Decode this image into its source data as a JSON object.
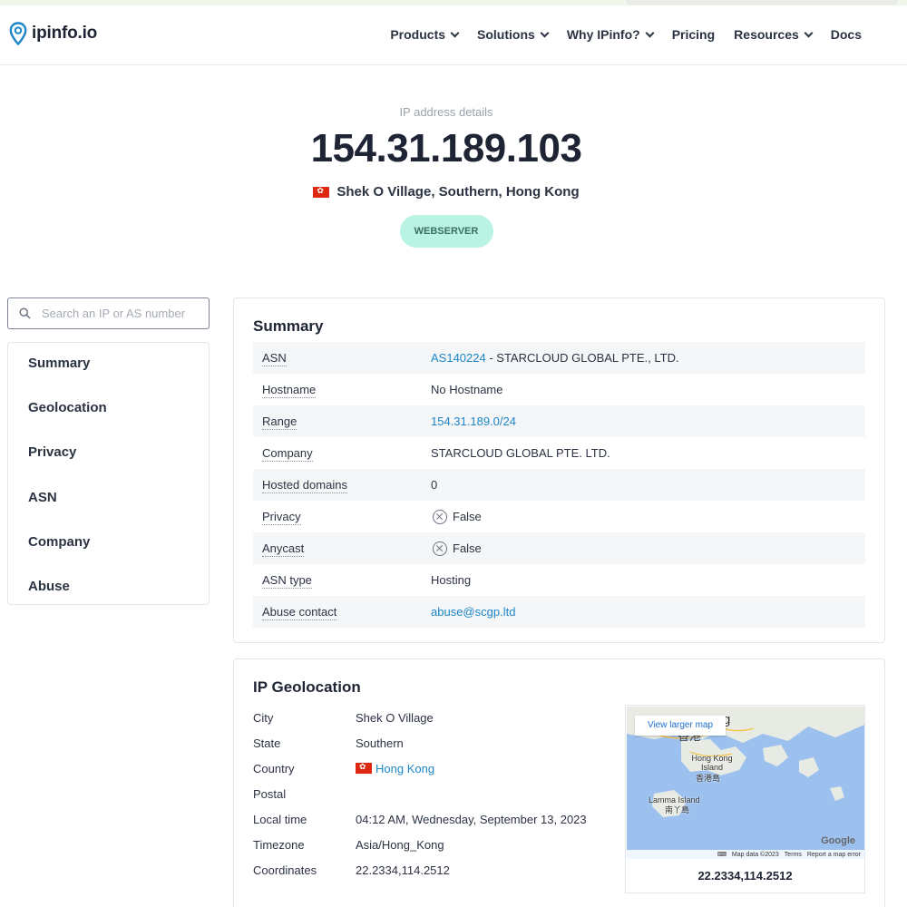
{
  "brand": {
    "name": "ipinfo.io",
    "accent": "#1c86c9"
  },
  "nav": [
    {
      "label": "Products",
      "dropdown": true
    },
    {
      "label": "Solutions",
      "dropdown": true
    },
    {
      "label": "Why IPinfo?",
      "dropdown": true
    },
    {
      "label": "Pricing",
      "dropdown": false
    },
    {
      "label": "Resources",
      "dropdown": true
    },
    {
      "label": "Docs",
      "dropdown": false
    }
  ],
  "hero": {
    "label": "IP address details",
    "ip": "154.31.189.103",
    "location": "Shek O Village, Southern, Hong Kong",
    "flag_color": "#de2910",
    "badge": "WEBSERVER"
  },
  "search": {
    "placeholder": "Search an IP or AS number",
    "value": ""
  },
  "sidenav": [
    "Summary",
    "Geolocation",
    "Privacy",
    "ASN",
    "Company",
    "Abuse"
  ],
  "summary": {
    "title": "Summary",
    "rows": {
      "asn": {
        "key": "ASN",
        "link": "AS140224",
        "rest": " - STARCLOUD GLOBAL PTE., LTD."
      },
      "hostname": {
        "key": "Hostname",
        "value": "No Hostname"
      },
      "range": {
        "key": "Range",
        "link": "154.31.189.0/24"
      },
      "company": {
        "key": "Company",
        "value": "STARCLOUD GLOBAL PTE. LTD."
      },
      "hosted_domains": {
        "key": "Hosted domains",
        "value": "0"
      },
      "privacy": {
        "key": "Privacy",
        "value": "False",
        "icon": "x-circle-icon"
      },
      "anycast": {
        "key": "Anycast",
        "value": "False",
        "icon": "x-circle-icon"
      },
      "asn_type": {
        "key": "ASN type",
        "value": "Hosting"
      },
      "abuse_contact": {
        "key": "Abuse contact",
        "link": "abuse@scgp.ltd"
      }
    }
  },
  "geolocation": {
    "title": "IP Geolocation",
    "rows": {
      "city": {
        "key": "City",
        "value": "Shek O Village"
      },
      "state": {
        "key": "State",
        "value": "Southern"
      },
      "country": {
        "key": "Country",
        "link": "Hong Kong"
      },
      "postal": {
        "key": "Postal",
        "value": ""
      },
      "local_time": {
        "key": "Local time",
        "value": "04:12 AM, Wednesday, September 13, 2023"
      },
      "timezone": {
        "key": "Timezone",
        "value": "Asia/Hong_Kong"
      },
      "coordinates": {
        "key": "Coordinates",
        "value": "22.2334,114.2512"
      }
    },
    "map": {
      "button": "View larger map",
      "labels": {
        "top": "g",
        "hk_cn": "香港",
        "hk_island": "Hong Kong Island",
        "hk_island_cn": "香港島",
        "lamma": "Lamma Island",
        "lamma_cn": "南丫島"
      },
      "google": "Google",
      "footer": {
        "data": "Map data ©2023",
        "terms": "Terms",
        "report": "Report a map error"
      },
      "coords": "22.2334,114.2512",
      "land_color": "#e8ebe3",
      "water_color": "#9dc1ef"
    }
  }
}
